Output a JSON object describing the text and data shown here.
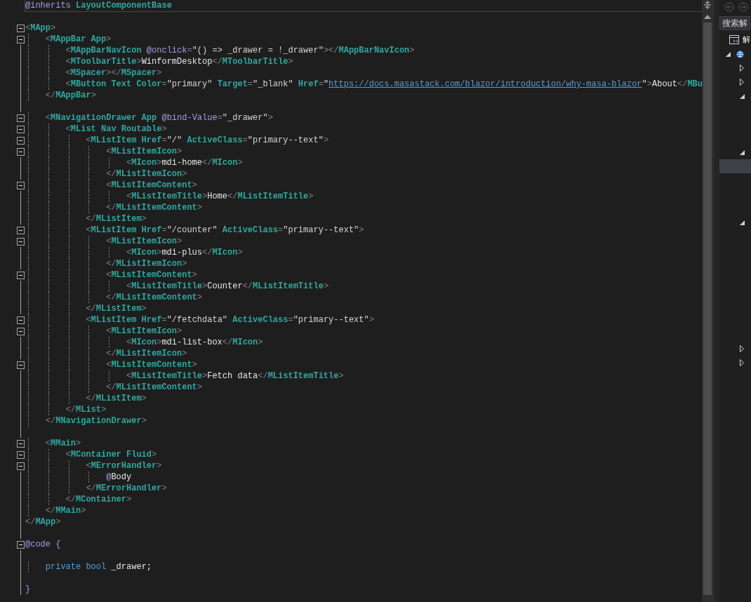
{
  "editor": {
    "lines": [
      {
        "fold": false,
        "tokens": [
          {
            "kind": "razor",
            "text": "@inherits"
          },
          {
            "kind": "tag",
            "text": " LayoutComponentBase"
          }
        ]
      },
      {
        "fold": false
      },
      {
        "fold": true,
        "tokens": [
          {
            "kind": "p",
            "text": "<"
          },
          {
            "kind": "tag",
            "text": "MApp"
          },
          {
            "kind": "p",
            "text": ">"
          }
        ]
      },
      {
        "fold": true,
        "tokens": [
          {
            "kind": "p",
            "text": "    <"
          },
          {
            "kind": "tag",
            "text": "MAppBar App"
          },
          {
            "kind": "p",
            "text": ">"
          }
        ]
      },
      {
        "fold": false,
        "tokens": [
          {
            "kind": "p",
            "text": "        <"
          },
          {
            "kind": "tag",
            "text": "MAppBarNavIcon"
          },
          {
            "kind": "razor",
            "text": " @onclick"
          },
          {
            "kind": "p",
            "text": "="
          },
          {
            "kind": "s",
            "text": "\"() => _drawer = !_drawer\""
          },
          {
            "kind": "p",
            "text": "></"
          },
          {
            "kind": "tag",
            "text": "MAppBarNavIcon"
          },
          {
            "kind": "p",
            "text": ">"
          }
        ]
      },
      {
        "fold": false,
        "tokens": [
          {
            "kind": "p",
            "text": "        <"
          },
          {
            "kind": "tag",
            "text": "MToolbarTitle"
          },
          {
            "kind": "p",
            "text": ">"
          },
          {
            "kind": "txt",
            "text": "WinformDesktop"
          },
          {
            "kind": "p",
            "text": "</"
          },
          {
            "kind": "tag",
            "text": "MToolbarTitle"
          },
          {
            "kind": "p",
            "text": ">"
          }
        ]
      },
      {
        "fold": false,
        "tokens": [
          {
            "kind": "p",
            "text": "        <"
          },
          {
            "kind": "tag",
            "text": "MSpacer"
          },
          {
            "kind": "p",
            "text": "></"
          },
          {
            "kind": "tag",
            "text": "MSpacer"
          },
          {
            "kind": "p",
            "text": ">"
          }
        ]
      },
      {
        "fold": false,
        "tokens": [
          {
            "kind": "p",
            "text": "        <"
          },
          {
            "kind": "tag",
            "text": "MButton Text Color"
          },
          {
            "kind": "p",
            "text": "="
          },
          {
            "kind": "s",
            "text": "\"primary\""
          },
          {
            "kind": "tag",
            "text": " Target"
          },
          {
            "kind": "p",
            "text": "="
          },
          {
            "kind": "s",
            "text": "\"_blank\""
          },
          {
            "kind": "tag",
            "text": " Href"
          },
          {
            "kind": "p",
            "text": "="
          },
          {
            "kind": "s",
            "text": "\""
          },
          {
            "kind": "link",
            "text": "https://docs.masastack.com/blazor/introduction/why-masa-blazor"
          },
          {
            "kind": "s",
            "text": "\""
          },
          {
            "kind": "p",
            "text": ">"
          },
          {
            "kind": "txt",
            "text": "About"
          },
          {
            "kind": "p",
            "text": "</"
          },
          {
            "kind": "tag",
            "text": "MBu"
          }
        ]
      },
      {
        "fold": false,
        "tokens": [
          {
            "kind": "p",
            "text": "    </"
          },
          {
            "kind": "tag",
            "text": "MAppBar"
          },
          {
            "kind": "p",
            "text": ">"
          }
        ]
      },
      {
        "fold": false
      },
      {
        "fold": true,
        "tokens": [
          {
            "kind": "p",
            "text": "    <"
          },
          {
            "kind": "tag",
            "text": "MNavigationDrawer App"
          },
          {
            "kind": "razor",
            "text": " @bind-Value"
          },
          {
            "kind": "p",
            "text": "="
          },
          {
            "kind": "s",
            "text": "\"_drawer\""
          },
          {
            "kind": "p",
            "text": ">"
          }
        ]
      },
      {
        "fold": true,
        "tokens": [
          {
            "kind": "p",
            "text": "        <"
          },
          {
            "kind": "tag",
            "text": "MList Nav Routable"
          },
          {
            "kind": "p",
            "text": ">"
          }
        ]
      },
      {
        "fold": true,
        "tokens": [
          {
            "kind": "p",
            "text": "            <"
          },
          {
            "kind": "tag",
            "text": "MListItem Href"
          },
          {
            "kind": "p",
            "text": "="
          },
          {
            "kind": "s",
            "text": "\"/\""
          },
          {
            "kind": "tag",
            "text": " ActiveClass"
          },
          {
            "kind": "p",
            "text": "="
          },
          {
            "kind": "s",
            "text": "\"primary--text\""
          },
          {
            "kind": "p",
            "text": ">"
          }
        ]
      },
      {
        "fold": true,
        "tokens": [
          {
            "kind": "p",
            "text": "                <"
          },
          {
            "kind": "tag",
            "text": "MListItemIcon"
          },
          {
            "kind": "p",
            "text": ">"
          }
        ]
      },
      {
        "fold": false,
        "tokens": [
          {
            "kind": "p",
            "text": "                    <"
          },
          {
            "kind": "tag",
            "text": "MIcon"
          },
          {
            "kind": "p",
            "text": ">"
          },
          {
            "kind": "txt",
            "text": "mdi-home"
          },
          {
            "kind": "p",
            "text": "</"
          },
          {
            "kind": "tag",
            "text": "MIcon"
          },
          {
            "kind": "p",
            "text": ">"
          }
        ]
      },
      {
        "fold": false,
        "tokens": [
          {
            "kind": "p",
            "text": "                </"
          },
          {
            "kind": "tag",
            "text": "MListItemIcon"
          },
          {
            "kind": "p",
            "text": ">"
          }
        ]
      },
      {
        "fold": true,
        "tokens": [
          {
            "kind": "p",
            "text": "                <"
          },
          {
            "kind": "tag",
            "text": "MListItemContent"
          },
          {
            "kind": "p",
            "text": ">"
          }
        ]
      },
      {
        "fold": false,
        "tokens": [
          {
            "kind": "p",
            "text": "                    <"
          },
          {
            "kind": "tag",
            "text": "MListItemTitle"
          },
          {
            "kind": "p",
            "text": ">"
          },
          {
            "kind": "txt",
            "text": "Home"
          },
          {
            "kind": "p",
            "text": "</"
          },
          {
            "kind": "tag",
            "text": "MListItemTitle"
          },
          {
            "kind": "p",
            "text": ">"
          }
        ]
      },
      {
        "fold": false,
        "tokens": [
          {
            "kind": "p",
            "text": "                </"
          },
          {
            "kind": "tag",
            "text": "MListItemContent"
          },
          {
            "kind": "p",
            "text": ">"
          }
        ]
      },
      {
        "fold": false,
        "tokens": [
          {
            "kind": "p",
            "text": "            </"
          },
          {
            "kind": "tag",
            "text": "MListItem"
          },
          {
            "kind": "p",
            "text": ">"
          }
        ]
      },
      {
        "fold": true,
        "tokens": [
          {
            "kind": "p",
            "text": "            <"
          },
          {
            "kind": "tag",
            "text": "MListItem Href"
          },
          {
            "kind": "p",
            "text": "="
          },
          {
            "kind": "s",
            "text": "\"/counter\""
          },
          {
            "kind": "tag",
            "text": " ActiveClass"
          },
          {
            "kind": "p",
            "text": "="
          },
          {
            "kind": "s",
            "text": "\"primary--text\""
          },
          {
            "kind": "p",
            "text": ">"
          }
        ]
      },
      {
        "fold": true,
        "tokens": [
          {
            "kind": "p",
            "text": "                <"
          },
          {
            "kind": "tag",
            "text": "MListItemIcon"
          },
          {
            "kind": "p",
            "text": ">"
          }
        ]
      },
      {
        "fold": false,
        "tokens": [
          {
            "kind": "p",
            "text": "                    <"
          },
          {
            "kind": "tag",
            "text": "MIcon"
          },
          {
            "kind": "p",
            "text": ">"
          },
          {
            "kind": "txt",
            "text": "mdi-plus"
          },
          {
            "kind": "p",
            "text": "</"
          },
          {
            "kind": "tag",
            "text": "MIcon"
          },
          {
            "kind": "p",
            "text": ">"
          }
        ]
      },
      {
        "fold": false,
        "tokens": [
          {
            "kind": "p",
            "text": "                </"
          },
          {
            "kind": "tag",
            "text": "MListItemIcon"
          },
          {
            "kind": "p",
            "text": ">"
          }
        ]
      },
      {
        "fold": true,
        "tokens": [
          {
            "kind": "p",
            "text": "                <"
          },
          {
            "kind": "tag",
            "text": "MListItemContent"
          },
          {
            "kind": "p",
            "text": ">"
          }
        ]
      },
      {
        "fold": false,
        "tokens": [
          {
            "kind": "p",
            "text": "                    <"
          },
          {
            "kind": "tag",
            "text": "MListItemTitle"
          },
          {
            "kind": "p",
            "text": ">"
          },
          {
            "kind": "txt",
            "text": "Counter"
          },
          {
            "kind": "p",
            "text": "</"
          },
          {
            "kind": "tag",
            "text": "MListItemTitle"
          },
          {
            "kind": "p",
            "text": ">"
          }
        ]
      },
      {
        "fold": false,
        "tokens": [
          {
            "kind": "p",
            "text": "                </"
          },
          {
            "kind": "tag",
            "text": "MListItemContent"
          },
          {
            "kind": "p",
            "text": ">"
          }
        ]
      },
      {
        "fold": false,
        "tokens": [
          {
            "kind": "p",
            "text": "            </"
          },
          {
            "kind": "tag",
            "text": "MListItem"
          },
          {
            "kind": "p",
            "text": ">"
          }
        ]
      },
      {
        "fold": true,
        "tokens": [
          {
            "kind": "p",
            "text": "            <"
          },
          {
            "kind": "tag",
            "text": "MListItem Href"
          },
          {
            "kind": "p",
            "text": "="
          },
          {
            "kind": "s",
            "text": "\"/fetchdata\""
          },
          {
            "kind": "tag",
            "text": " ActiveClass"
          },
          {
            "kind": "p",
            "text": "="
          },
          {
            "kind": "s",
            "text": "\"primary--text\""
          },
          {
            "kind": "p",
            "text": ">"
          }
        ]
      },
      {
        "fold": true,
        "tokens": [
          {
            "kind": "p",
            "text": "                <"
          },
          {
            "kind": "tag",
            "text": "MListItemIcon"
          },
          {
            "kind": "p",
            "text": ">"
          }
        ]
      },
      {
        "fold": false,
        "tokens": [
          {
            "kind": "p",
            "text": "                    <"
          },
          {
            "kind": "tag",
            "text": "MIcon"
          },
          {
            "kind": "p",
            "text": ">"
          },
          {
            "kind": "txt",
            "text": "mdi-list-box"
          },
          {
            "kind": "p",
            "text": "</"
          },
          {
            "kind": "tag",
            "text": "MIcon"
          },
          {
            "kind": "p",
            "text": ">"
          }
        ]
      },
      {
        "fold": false,
        "tokens": [
          {
            "kind": "p",
            "text": "                </"
          },
          {
            "kind": "tag",
            "text": "MListItemIcon"
          },
          {
            "kind": "p",
            "text": ">"
          }
        ]
      },
      {
        "fold": true,
        "tokens": [
          {
            "kind": "p",
            "text": "                <"
          },
          {
            "kind": "tag",
            "text": "MListItemContent"
          },
          {
            "kind": "p",
            "text": ">"
          }
        ]
      },
      {
        "fold": false,
        "tokens": [
          {
            "kind": "p",
            "text": "                    <"
          },
          {
            "kind": "tag",
            "text": "MListItemTitle"
          },
          {
            "kind": "p",
            "text": ">"
          },
          {
            "kind": "txt",
            "text": "Fetch data"
          },
          {
            "kind": "p",
            "text": "</"
          },
          {
            "kind": "tag",
            "text": "MListItemTitle"
          },
          {
            "kind": "p",
            "text": ">"
          }
        ]
      },
      {
        "fold": false,
        "tokens": [
          {
            "kind": "p",
            "text": "                </"
          },
          {
            "kind": "tag",
            "text": "MListItemContent"
          },
          {
            "kind": "p",
            "text": ">"
          }
        ]
      },
      {
        "fold": false,
        "tokens": [
          {
            "kind": "p",
            "text": "            </"
          },
          {
            "kind": "tag",
            "text": "MListItem"
          },
          {
            "kind": "p",
            "text": ">"
          }
        ]
      },
      {
        "fold": false,
        "tokens": [
          {
            "kind": "p",
            "text": "        </"
          },
          {
            "kind": "tag",
            "text": "MList"
          },
          {
            "kind": "p",
            "text": ">"
          }
        ]
      },
      {
        "fold": false,
        "tokens": [
          {
            "kind": "p",
            "text": "    </"
          },
          {
            "kind": "tag",
            "text": "MNavigationDrawer"
          },
          {
            "kind": "p",
            "text": ">"
          }
        ]
      },
      {
        "fold": false
      },
      {
        "fold": true,
        "tokens": [
          {
            "kind": "p",
            "text": "    <"
          },
          {
            "kind": "tag",
            "text": "MMain"
          },
          {
            "kind": "p",
            "text": ">"
          }
        ]
      },
      {
        "fold": true,
        "tokens": [
          {
            "kind": "p",
            "text": "        <"
          },
          {
            "kind": "tag",
            "text": "MContainer Fluid"
          },
          {
            "kind": "p",
            "text": ">"
          }
        ]
      },
      {
        "fold": true,
        "tokens": [
          {
            "kind": "p",
            "text": "            <"
          },
          {
            "kind": "tag",
            "text": "MErrorHandler"
          },
          {
            "kind": "p",
            "text": ">"
          }
        ]
      },
      {
        "fold": false,
        "tokens": [
          {
            "kind": "razor",
            "text": "                @"
          },
          {
            "kind": "txt",
            "text": "Body"
          }
        ]
      },
      {
        "fold": false,
        "tokens": [
          {
            "kind": "p",
            "text": "            </"
          },
          {
            "kind": "tag",
            "text": "MErrorHandler"
          },
          {
            "kind": "p",
            "text": ">"
          }
        ]
      },
      {
        "fold": false,
        "tokens": [
          {
            "kind": "p",
            "text": "        </"
          },
          {
            "kind": "tag",
            "text": "MContainer"
          },
          {
            "kind": "p",
            "text": ">"
          }
        ]
      },
      {
        "fold": false,
        "tokens": [
          {
            "kind": "p",
            "text": "    </"
          },
          {
            "kind": "tag",
            "text": "MMain"
          },
          {
            "kind": "p",
            "text": ">"
          }
        ]
      },
      {
        "fold": false,
        "tokens": [
          {
            "kind": "p",
            "text": "</"
          },
          {
            "kind": "tag",
            "text": "MApp"
          },
          {
            "kind": "p",
            "text": ">"
          }
        ]
      },
      {
        "fold": false
      },
      {
        "fold": true,
        "tokens": [
          {
            "kind": "razor",
            "text": "@code {"
          }
        ]
      },
      {
        "fold": false
      },
      {
        "fold": false,
        "tokens": [
          {
            "kind": "kw",
            "text": "    private bool"
          },
          {
            "kind": "txt",
            "text": " _drawer;"
          }
        ]
      },
      {
        "fold": false
      },
      {
        "fold": false,
        "tokens": [
          {
            "kind": "razor",
            "text": "}"
          }
        ]
      }
    ]
  },
  "solution_explorer": {
    "search": {
      "placeholder": "搜索解"
    },
    "tree": [
      {
        "kind": "solution",
        "label": "解",
        "selected": false,
        "children": [
          {
            "kind": "project",
            "expanded": true,
            "selected": false,
            "children": [
              {
                "kind": "folder",
                "expanded": false,
                "selected": false
              },
              {
                "kind": "folder",
                "expanded": false,
                "selected": false
              },
              {
                "kind": "folder",
                "expanded": true,
                "selected": false
              },
              {
                "kind": "item",
                "selected": false
              },
              {
                "kind": "item",
                "selected": false
              },
              {
                "kind": "item",
                "selected": false
              },
              {
                "kind": "folder",
                "expanded": true,
                "selected": false
              },
              {
                "kind": "item",
                "selected": true
              },
              {
                "kind": "item",
                "selected": false
              },
              {
                "kind": "item",
                "selected": false
              },
              {
                "kind": "item",
                "selected": false
              },
              {
                "kind": "folder",
                "expanded": true,
                "selected": false
              },
              {
                "kind": "item",
                "selected": false
              },
              {
                "kind": "item",
                "selected": false
              },
              {
                "kind": "item",
                "selected": false
              },
              {
                "kind": "item",
                "selected": false
              },
              {
                "kind": "item",
                "selected": false
              },
              {
                "kind": "item",
                "selected": false
              },
              {
                "kind": "item",
                "selected": false
              },
              {
                "kind": "item",
                "selected": false
              },
              {
                "kind": "folder",
                "expanded": false,
                "selected": false
              },
              {
                "kind": "folder",
                "expanded": false,
                "selected": false
              }
            ]
          }
        ]
      }
    ]
  }
}
